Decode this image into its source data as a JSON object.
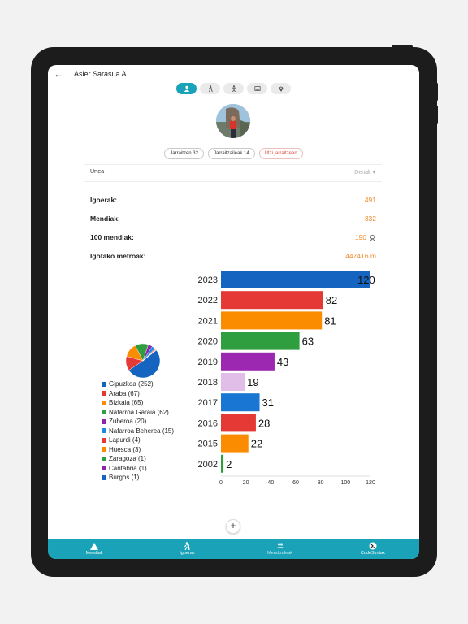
{
  "header": {
    "back_icon": "arrow-left-icon",
    "user_name": "Asier Sarasua A."
  },
  "tabs": [
    {
      "icon": "person-icon",
      "active": true
    },
    {
      "icon": "hiker-icon",
      "active": false
    },
    {
      "icon": "summit-icon",
      "active": false
    },
    {
      "icon": "photos-icon",
      "active": false
    },
    {
      "icon": "location-pin-icon",
      "active": false
    }
  ],
  "profile": {
    "following_label": "Jarraitzen 32",
    "followers_label": "Jarraitzaileak 14",
    "unfollow_label": "Utzi jarraitzean"
  },
  "filter": {
    "year_label": "Urtea",
    "year_value": "Denak"
  },
  "stats": [
    {
      "label": "Igoerak:",
      "value": "491"
    },
    {
      "label": "Mendiak:",
      "value": "332"
    },
    {
      "label": "100 mendiak:",
      "value": "190"
    },
    {
      "label": "Igotako metroak:",
      "value": "447416 m"
    }
  ],
  "colors": {
    "accent": "#1aa3b8",
    "orange": "#f08a2a",
    "danger": "#e04b3a"
  },
  "chart_data": [
    {
      "type": "pie",
      "labels": [
        "Gipuzkoa (252)",
        "Araba (67)",
        "Bizkaia (65)",
        "Nafarroa Garaia (62)",
        "Zuberoa (20)",
        "Nafarroa Beherea (15)",
        "Lapurdi (4)",
        "Huesca (3)",
        "Zaragoza (1)",
        "Cantabria (1)",
        "Burgos (1)"
      ],
      "values": [
        252,
        67,
        65,
        62,
        20,
        15,
        4,
        3,
        1,
        1,
        1
      ],
      "colors": [
        "#1565c0",
        "#e53935",
        "#fb8c00",
        "#2e9e3e",
        "#8e24aa",
        "#1e88e5",
        "#e53935",
        "#fb8c00",
        "#2e9e3e",
        "#8e24aa",
        "#1565c0"
      ],
      "legend": "left"
    },
    {
      "type": "bar",
      "orientation": "horizontal",
      "categories": [
        "2023",
        "2022",
        "2021",
        "2020",
        "2019",
        "2018",
        "2017",
        "2016",
        "2015",
        "2002"
      ],
      "values": [
        120,
        82,
        81,
        63,
        43,
        19,
        31,
        28,
        22,
        2
      ],
      "colors": [
        "#1565c0",
        "#e53935",
        "#fb8c00",
        "#2e9e3e",
        "#9c27b0",
        "#e1bee7",
        "#1976d2",
        "#e53935",
        "#fb8c00",
        "#2e9e3e"
      ],
      "xlim": [
        0,
        120
      ],
      "xticks": [
        0,
        20,
        40,
        60,
        80,
        100,
        120
      ],
      "grid": false
    }
  ],
  "fab": {
    "label": "+"
  },
  "bottom_nav": [
    {
      "label": "Mendiak",
      "icon": "mountain-icon",
      "dim": false
    },
    {
      "label": "Igoerak",
      "icon": "hiker-icon",
      "dim": false
    },
    {
      "label": "Mendizaleak",
      "icon": "people-icon",
      "dim": true
    },
    {
      "label": "CodeSyntax",
      "icon": "codesyntax-logo-icon",
      "dim": false
    }
  ]
}
